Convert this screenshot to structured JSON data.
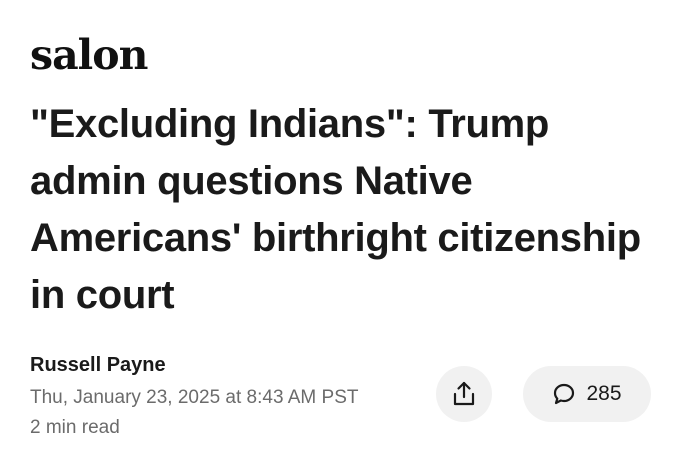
{
  "brand": {
    "logo_text": "salon"
  },
  "article": {
    "headline": "\"Excluding Indians\": Trump admin questions Native Americans' birthright citizenship in court",
    "author": "Russell Payne",
    "date": "Thu, January 23, 2025 at 8:43 AM PST",
    "read_time": "2 min read"
  },
  "actions": {
    "share_icon": "share-icon",
    "comment_icon": "speech-bubble-icon",
    "comment_count": "285"
  }
}
